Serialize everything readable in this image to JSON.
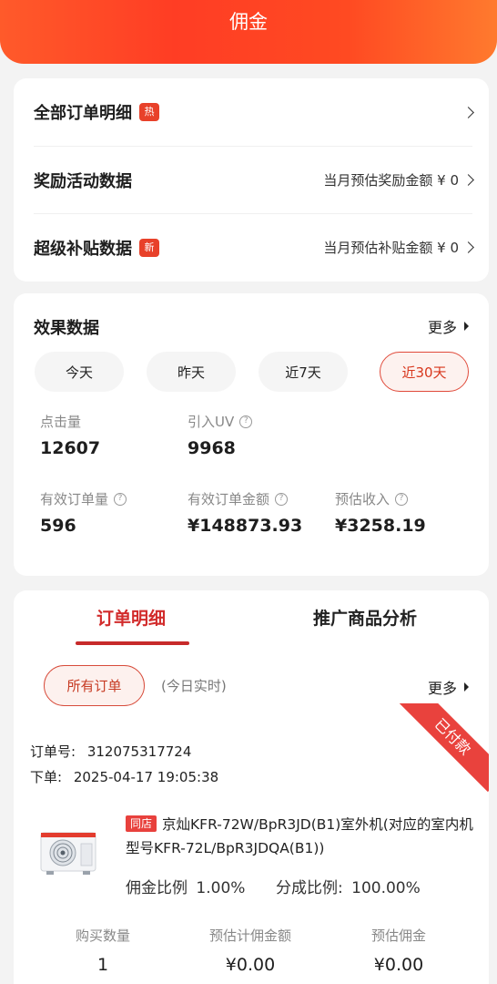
{
  "header": {
    "title": "佣金"
  },
  "menu": {
    "items": [
      {
        "label": "全部订单明细",
        "badge": "热",
        "right": ""
      },
      {
        "label": "奖励活动数据",
        "badge": "",
        "right": "当月预估奖励金额 ¥ 0"
      },
      {
        "label": "超级补贴数据",
        "badge": "新",
        "right": "当月预估补贴金额 ¥ 0"
      }
    ]
  },
  "effect": {
    "title": "效果数据",
    "more": "更多",
    "periods": [
      "今天",
      "昨天",
      "近7天",
      "近30天"
    ],
    "active_period": "近30天",
    "metrics": [
      {
        "label": "点击量",
        "value": "12607",
        "help": false
      },
      {
        "label": "引入UV",
        "value": "9968",
        "help": true
      },
      {
        "label": "有效订单量",
        "value": "596",
        "help": true
      },
      {
        "label": "有效订单金额",
        "value": "¥148873.93",
        "help": true
      },
      {
        "label": "预估收入",
        "value": "¥3258.19",
        "help": true
      }
    ]
  },
  "orders": {
    "tabs": [
      "订单明细",
      "推广商品分析"
    ],
    "active_tab": "订单明细",
    "filter": "所有订单",
    "filter_note": "(今日实时)",
    "more": "更多",
    "status": "已付款",
    "order_no_label": "订单号:",
    "order_no": "312075317724",
    "order_time_label": "下单:",
    "order_time": "2025-04-17 19:05:38",
    "product": {
      "tag": "同店",
      "title": "京灿KFR-72W/BpR3JD(B1)室外机(对应的室内机型号KFR-72L/BpR3JDQA(B1))",
      "commission_rate_label": "佣金比例",
      "commission_rate": "1.00%",
      "share_rate_label": "分成比例:",
      "share_rate": "100.00%"
    },
    "columns": [
      {
        "label": "购买数量",
        "value": "1"
      },
      {
        "label": "预估计佣金额",
        "value": "¥0.00"
      },
      {
        "label": "预估佣金",
        "value": "¥0.00"
      }
    ]
  },
  "colors": {
    "accent": "#e8412a",
    "header": "#ff4a24",
    "active_border": "#e04a3a"
  }
}
